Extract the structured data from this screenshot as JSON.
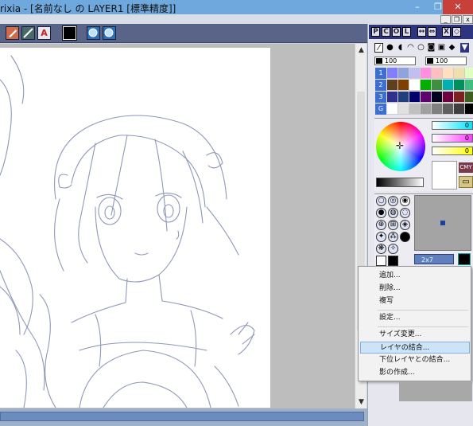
{
  "window": {
    "title": "rixia - [名前なし の LAYER1 [標準精度]]",
    "min_glyph": "–",
    "max_glyph": "❐",
    "close_glyph": "✕"
  },
  "mdi": {
    "min": "_",
    "restore": "❐",
    "close": "x"
  },
  "toolbar": {
    "icons": [
      "brush-stamp-icon",
      "pen-line-icon",
      "text-a-icon",
      "black-color-swatch",
      "zoom-in-icon",
      "zoom-out-icon"
    ],
    "text_glyph": "A",
    "active_color": "#000000"
  },
  "panel": {
    "header_buttons": [
      "P",
      "C",
      "O",
      "L"
    ],
    "header_extra": [
      "↔",
      "⇔",
      "X",
      "◇"
    ],
    "size_labels": [
      "100",
      "100"
    ],
    "palette_rows": [
      "1",
      "2",
      "3",
      "G"
    ],
    "palette_colors": [
      [
        "#7f7fff",
        "#8fa3df",
        "#c0bfef",
        "#ff8fdf",
        "#ffbfbf",
        "#ffdfbf",
        "#efdfaf",
        "#dfffbf"
      ],
      [
        "#5f3f1f",
        "#7f3f00",
        "#ffffff",
        "#00af00",
        "#3f8f3f",
        "#00afaf",
        "#008f5f",
        "#3fbf7f"
      ],
      [
        "#2f2f8f",
        "#1f3f7f",
        "#00006f",
        "#5f006f",
        "#00001f",
        "#6f003f",
        "#7f1f1f",
        "#3f5f1f"
      ],
      [
        "#ffffff",
        "#e0e0e0",
        "#c0c0c0",
        "#a0a0a0",
        "#808080",
        "#606060",
        "#404040",
        "#000000"
      ]
    ],
    "cmy": {
      "c": "0",
      "m": "0",
      "y": "0"
    },
    "cmy_button": "CMY",
    "brush_size": "2x7"
  },
  "context_menu": {
    "items": [
      {
        "label": "追加..."
      },
      {
        "label": "削除..."
      },
      {
        "label": "複写"
      },
      {
        "label": "設定..."
      },
      {
        "label": "サイズ変更..."
      },
      {
        "label": "レイヤの結合..."
      },
      {
        "label": "下位レイヤとの結合..."
      },
      {
        "label": "影の作成..."
      }
    ],
    "highlighted_index": 5
  },
  "scroll": {
    "up": "▲",
    "down": "▼"
  }
}
